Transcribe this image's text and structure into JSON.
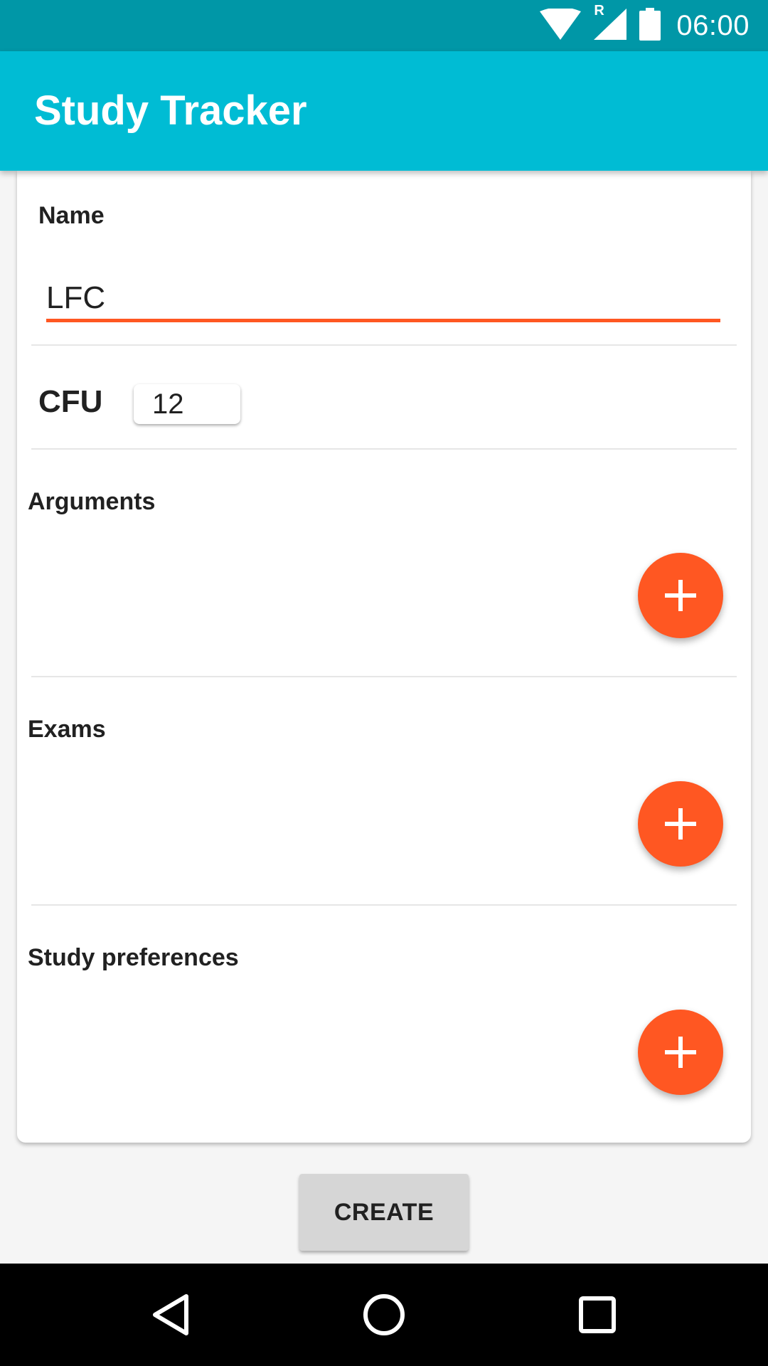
{
  "status_bar": {
    "time": "06:00",
    "icons": [
      "wifi-icon",
      "signal-icon",
      "battery-icon"
    ],
    "roaming_indicator": "R"
  },
  "app_bar": {
    "title": "Study Tracker",
    "color": "#00bcd4"
  },
  "form": {
    "name": {
      "label": "Name",
      "value": "LFC"
    },
    "cfu": {
      "label": "CFU",
      "value": "12"
    },
    "sections": [
      {
        "label": "Arguments",
        "add_icon": "plus-icon"
      },
      {
        "label": "Exams",
        "add_icon": "plus-icon"
      },
      {
        "label": "Study preferences",
        "add_icon": "plus-icon"
      }
    ],
    "accent_color": "#ff5722"
  },
  "create_button": {
    "label": "CREATE"
  },
  "nav_bar": {
    "icons": [
      "back-icon",
      "home-icon",
      "recents-icon"
    ]
  }
}
